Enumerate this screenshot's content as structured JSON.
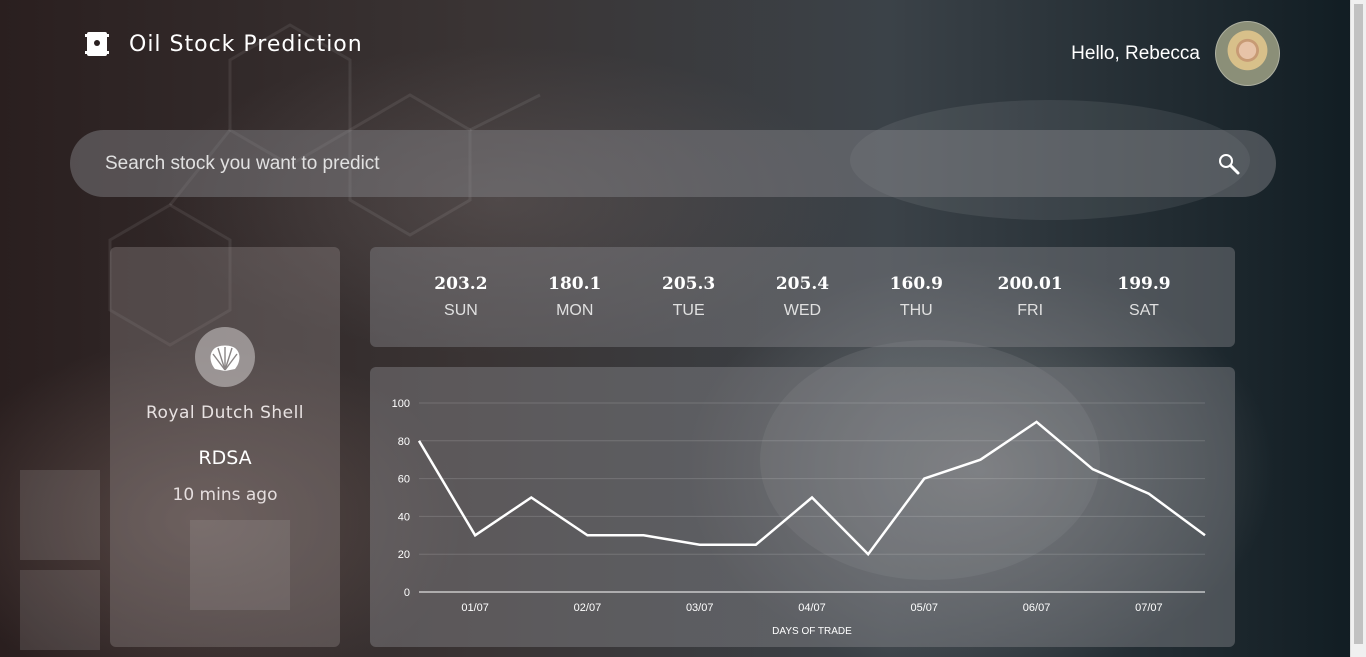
{
  "header": {
    "app_title": "Oil Stock Prediction",
    "greeting": "Hello, Rebecca"
  },
  "search": {
    "placeholder": "Search stock you want to predict",
    "value": ""
  },
  "company": {
    "name": "Royal Dutch Shell",
    "ticker": "RDSA",
    "updated": "10 mins ago",
    "logo_icon": "shell-icon"
  },
  "forecast": {
    "days": [
      {
        "value": "203.2",
        "day": "SUN"
      },
      {
        "value": "180.1",
        "day": "MON"
      },
      {
        "value": "205.3",
        "day": "TUE"
      },
      {
        "value": "205.4",
        "day": "WED"
      },
      {
        "value": "160.9",
        "day": "THU"
      },
      {
        "value": "200.01",
        "day": "FRI"
      },
      {
        "value": "199.9",
        "day": "SAT"
      }
    ]
  },
  "chart_data": {
    "type": "line",
    "xlabel": "DAYS OF TRADE",
    "ylabel": "",
    "ylim": [
      0,
      100
    ],
    "y_ticks": [
      0,
      20,
      40,
      60,
      80,
      100
    ],
    "x_ticks": [
      "01/07",
      "02/07",
      "03/07",
      "04/07",
      "05/07",
      "06/07",
      "07/07"
    ],
    "x_tick_positions": [
      1,
      3,
      5,
      7,
      9,
      11,
      13
    ],
    "grid": true,
    "series": [
      {
        "values": [
          80,
          30,
          50,
          30,
          30,
          25,
          25,
          50,
          20,
          60,
          70,
          90,
          65,
          52,
          30
        ],
        "color": "#ffffff"
      }
    ]
  },
  "colors": {
    "panel": "rgba(140,140,145,0.42)",
    "text": "#ffffff"
  }
}
